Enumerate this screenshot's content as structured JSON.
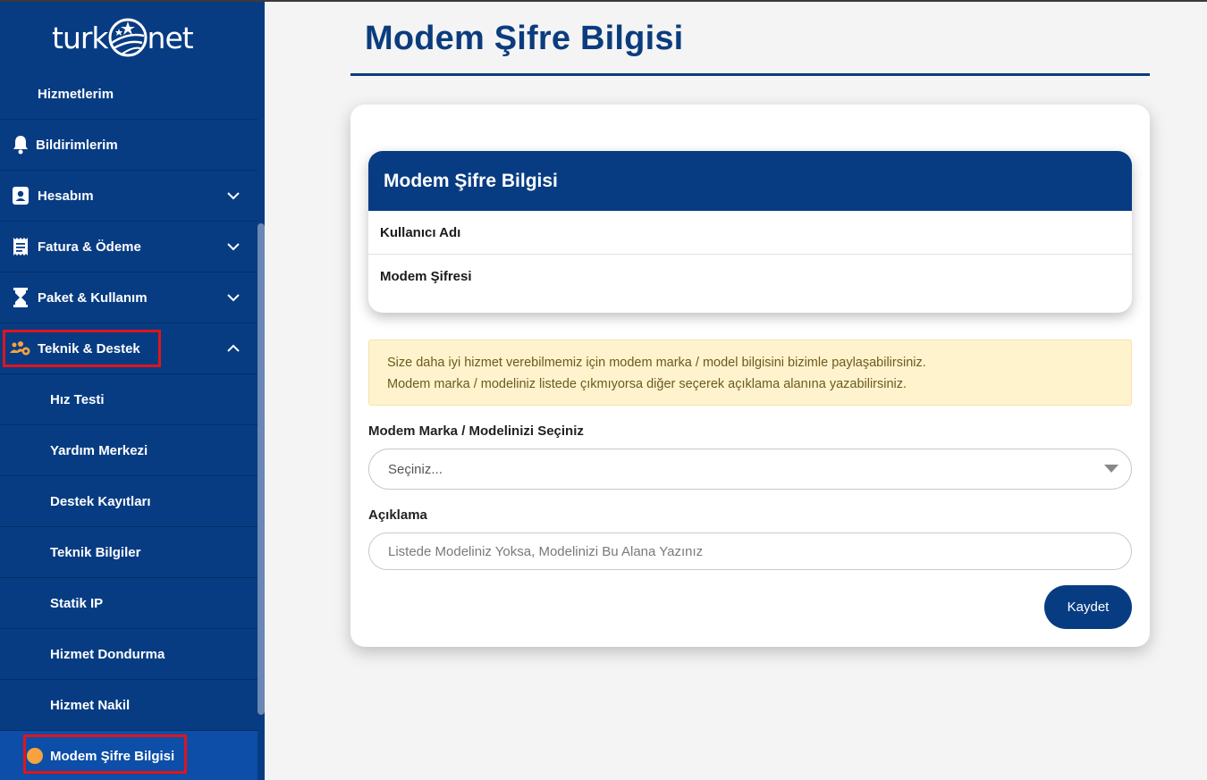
{
  "brand": {
    "logo_left": "turk",
    "logo_right": "net"
  },
  "sidebar": {
    "items": [
      {
        "label": "Hizmetlerim",
        "icon": "none"
      },
      {
        "label": "Bildirimlerim",
        "icon": "bell-icon"
      },
      {
        "label": "Hesabım",
        "icon": "contact-card-icon",
        "expandable": true
      },
      {
        "label": "Fatura & Ödeme",
        "icon": "receipt-icon",
        "expandable": true
      },
      {
        "label": "Paket & Kullanım",
        "icon": "hourglass-icon",
        "expandable": true
      },
      {
        "label": "Teknik & Destek",
        "icon": "team-gear-icon",
        "expanded": true
      }
    ],
    "subitems": [
      {
        "label": "Hız Testi"
      },
      {
        "label": "Yardım Merkezi"
      },
      {
        "label": "Destek Kayıtları"
      },
      {
        "label": "Teknik Bilgiler"
      },
      {
        "label": "Statik IP"
      },
      {
        "label": "Hizmet Dondurma"
      },
      {
        "label": "Hizmet Nakil"
      },
      {
        "label": "Modem Şifre Bilgisi",
        "active": true
      }
    ]
  },
  "main": {
    "page_title": "Modem Şifre Bilgisi",
    "info_card": {
      "title": "Modem Şifre Bilgisi",
      "rows": [
        {
          "label": "Kullanıcı Adı"
        },
        {
          "label": "Modem Şifresi"
        }
      ]
    },
    "alert": {
      "line1": "Size daha iyi hizmet verebilmemiz için modem marka / model bilgisini bizimle paylaşabilirsiniz.",
      "line2": "Modem marka / modeliniz listede çıkmıyorsa diğer seçerek açıklama alanına yazabilirsiniz."
    },
    "model_select": {
      "label": "Modem Marka / Modelinizi Seçiniz",
      "value": "Seçiniz..."
    },
    "description": {
      "label": "Açıklama",
      "placeholder": "Listede Modeliniz Yoksa, Modelinizi Bu Alana Yazınız"
    },
    "save_label": "Kaydet"
  },
  "colors": {
    "sidebar_bg": "#073c83",
    "active_item_bg": "#0c4ea8",
    "highlight_border": "#e1141c",
    "alert_bg": "#fff3cd",
    "active_dot": "#f6a33d"
  }
}
